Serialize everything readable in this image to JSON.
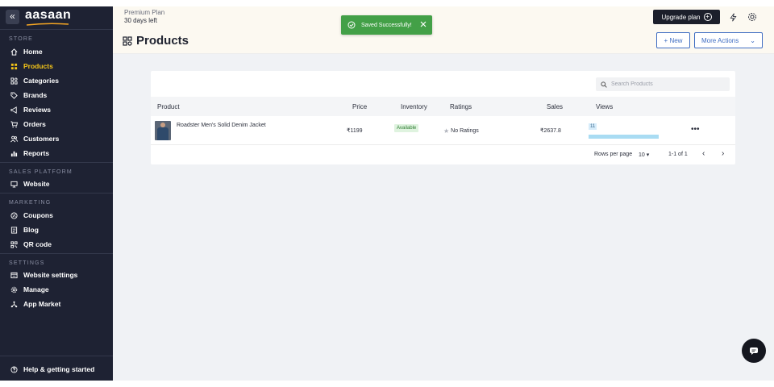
{
  "brand": {
    "logo": "aasaan",
    "collapse": "«"
  },
  "sidebar": {
    "sections": [
      {
        "label": "STORE",
        "items": [
          {
            "label": "Home",
            "icon": "home-icon"
          },
          {
            "label": "Products",
            "icon": "grid-icon",
            "active": true
          },
          {
            "label": "Categories",
            "icon": "categories-icon"
          },
          {
            "label": "Brands",
            "icon": "tag-icon"
          },
          {
            "label": "Reviews",
            "icon": "megaphone-icon"
          },
          {
            "label": "Orders",
            "icon": "cart-icon"
          },
          {
            "label": "Customers",
            "icon": "users-icon"
          },
          {
            "label": "Reports",
            "icon": "bar-chart-icon"
          }
        ]
      },
      {
        "label": "SALES PLATFORM",
        "items": [
          {
            "label": "Website",
            "icon": "monitor-icon"
          }
        ]
      },
      {
        "label": "MARKETING",
        "items": [
          {
            "label": "Coupons",
            "icon": "percent-icon"
          },
          {
            "label": "Blog",
            "icon": "document-icon"
          },
          {
            "label": "QR code",
            "icon": "qr-icon"
          }
        ]
      },
      {
        "label": "SETTINGS",
        "items": [
          {
            "label": "Website settings",
            "icon": "browser-icon"
          },
          {
            "label": "Manage",
            "icon": "gear-icon"
          },
          {
            "label": "App Market",
            "icon": "nodes-icon"
          }
        ]
      }
    ],
    "help": {
      "label": "Help & getting started",
      "icon": "help-icon"
    }
  },
  "topbar": {
    "plan_name": "Premium Plan",
    "plan_days": "30 days left",
    "upgrade_label": "Upgrade plan",
    "upgrade_icon": "plus-circle-icon"
  },
  "toast": {
    "message": "Saved Successfully!",
    "color": "#43a047"
  },
  "page": {
    "title": "Products",
    "new_label": "+ New",
    "more_label": "More Actions",
    "more_caret": "⌄"
  },
  "search": {
    "placeholder": "Search Products"
  },
  "table": {
    "columns": [
      "Product",
      "Price",
      "Inventory",
      "Ratings",
      "Sales",
      "Views"
    ],
    "rows": [
      {
        "name": "Roadster Men's Solid Denim Jacket",
        "price": "₹1199",
        "inventory": "Available",
        "rating_star": "★",
        "rating": "No Ratings",
        "sales": "₹2637.8",
        "views": "11",
        "views_fraction": 1.0,
        "menu": "•••"
      }
    ]
  },
  "pager": {
    "rows_per_page_label": "Rows per page",
    "rows_per_page_value": "10 ▾",
    "range": "1-1 of 1",
    "prev": "‹",
    "next": "›"
  },
  "colors": {
    "sidebar_bg": "#1e2233",
    "active": "#f5c518",
    "accent": "#3f6dc2",
    "success": "#43a047"
  }
}
